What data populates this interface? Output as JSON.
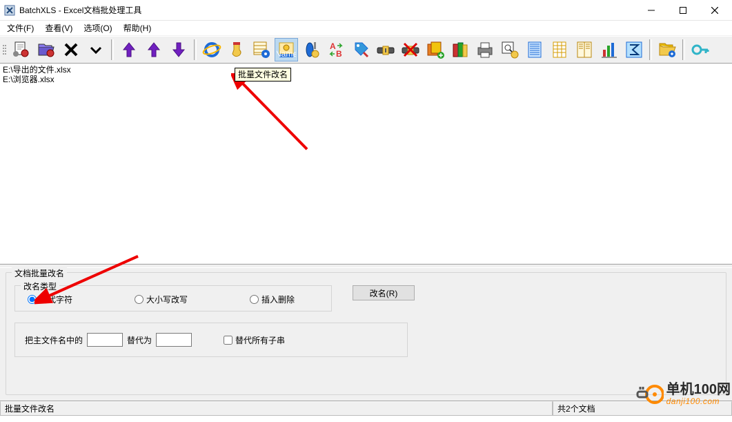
{
  "window": {
    "title": "BatchXLS - Excel文档批处理工具",
    "btn_min": "—",
    "btn_max": "☐",
    "btn_close": "✕"
  },
  "menu": {
    "file": "文件(F)",
    "view": "查看(V)",
    "option": "选项(O)",
    "help": "帮助(H)"
  },
  "toolbar": {
    "tooltip_rename": "批量文件改名",
    "icons": {
      "add_doc": "add-doc-icon",
      "add_folder": "add-folder-icon",
      "remove": "remove-icon",
      "down_nav": "down-nav-icon",
      "up1": "up-arrow-icon",
      "up2": "up-arrow-alt-icon",
      "down2": "down-arrow-icon",
      "ie": "ie-icon",
      "sock": "sock-icon",
      "panel": "panel-gear-icon",
      "name": "name-tag-icon",
      "attach": "attach-icon",
      "ab": "ab-replace-icon",
      "tag": "tag-icon",
      "belt": "belt-icon",
      "belt_del": "belt-delete-icon",
      "sheets": "sheets-icon",
      "books": "books-icon",
      "printer": "printer-icon",
      "search_set": "search-settings-icon",
      "page_blue": "page-blue-icon",
      "page_grid": "page-grid-icon",
      "pages": "pages-icon",
      "bar_chart": "bar-chart-icon",
      "sigma": "sigma-icon",
      "open_folder": "open-folder-icon",
      "key": "key-icon"
    }
  },
  "files": [
    "E:\\导出的文件.xlsx",
    "E:\\浏览器.xlsx"
  ],
  "panel": {
    "group_title": "文档批量改名",
    "type_title": "改名类型",
    "opt_replace": "替代字符",
    "opt_case": "大小写改写",
    "opt_insert": "插入删除",
    "btn_rename": "改名(R)",
    "replace_prefix": "把主文件名中的",
    "replace_mid": "替代为",
    "find_value": "",
    "to_value": "",
    "cb_allsub": "替代所有子串"
  },
  "status": {
    "left": "批量文件改名",
    "right": "共2个文档"
  },
  "watermark": {
    "name": "单机100网",
    "url": "danji100.com"
  }
}
